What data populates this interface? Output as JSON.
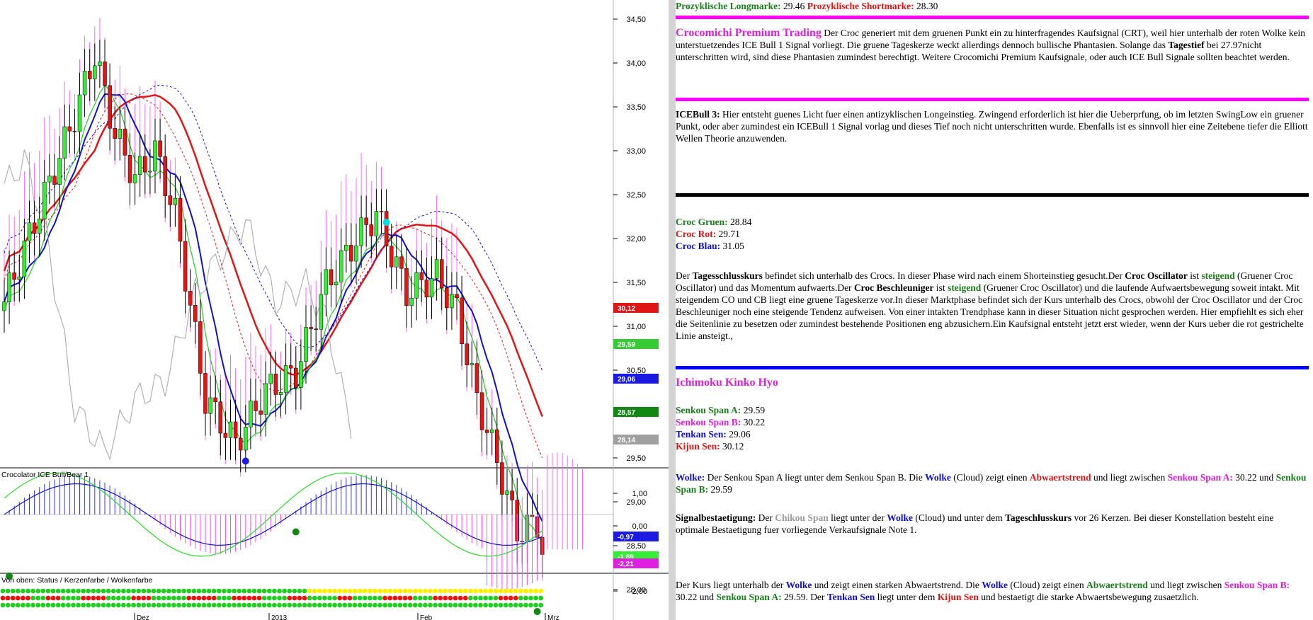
{
  "chart": {
    "price_axis": [
      "34,50",
      "34,00",
      "33,50",
      "33,00",
      "32,50",
      "32,00",
      "31,50",
      "31,00",
      "30,50",
      "30,00",
      "29,50",
      "29,00",
      "28,50",
      "28,00"
    ],
    "osc_axis": [
      "1,00",
      "0,00",
      "-1,00",
      "-2,00"
    ],
    "time_axis": [
      "Dez",
      "2013",
      "Feb",
      "Mrz"
    ],
    "price_markers": [
      {
        "text": "30,12",
        "color": "#e01616"
      },
      {
        "text": "29,59",
        "color": "#33cc33"
      },
      {
        "text": "29,06",
        "color": "#1a1ae0"
      },
      {
        "text": "28,57",
        "color": "#118811"
      },
      {
        "text": "28,14",
        "color": "#a0a0a0"
      }
    ],
    "osc_markers": [
      {
        "text": "-0,97",
        "color": "#1a1ae0"
      },
      {
        "text": "-1,89",
        "color": "#33ee33"
      },
      {
        "text": "-2,21",
        "color": "#e020e0"
      }
    ],
    "osc_title": "Crocolator  ICE Bull/Bear 1",
    "status_title": "Von oben: Status / Kerzenfarbe / Wolkenfarbe",
    "rows": [
      "GGGGGGGGGGGGGGGGGGGGGGGGGGGGGGGGGGGGGGGGGGGGGGGGGGGGGGGGGGGGGYYYYYYYYYYYYYYYYYYYYYYYYYYYYYYYYYYYYYYYYYYYYYYYYGGGGGGGGGGGGGGGGGGGGGGGGGGGGRRRRRRRRRRRRRRRRRRRR",
      "RRRRRRGGGRRRGGGGRRRRRGGGGGRRRRGGGGGGGRRRRRRGGGRRRRRRGGGGGRRRRGGGGGGRRRGGGGGGRRRRRRGGGGRRRRRRRGGGGGGRRRRGGGGGGRRRRRGGGGGGGRRRRRRRGGGGGRRRRRGGGRRRRRRRGGRRRR",
      "GGGGGGGGGGGGGGGGGGGGGGGGGGGGGGGGGGGGGGGGGGGGGGGGGGGGGGGGGGGGGGGGGGGGGGGGGGGGGGGGGGGGGGGGGGGGGGGGGGGGGGGGGGGGGGGGGGGGGGGGGRRRRRRRRRRRRRRRRRRRRRRRRRRRRRRRRRRR"
    ]
  },
  "panel": {
    "line1_long_label": "Prozyklische Longmarke:",
    "line1_long_value": "29.46",
    "line1_short_label": "Prozyklische Shortmarke:",
    "line1_short_value": "28.30",
    "crt_title": "Crocomichi Premium Trading",
    "crt_text1": " Der Croc generiert mit dem gruenen Punkt ein zu hinterfragendes Kaufsignal (CRT), weil hier unterhalb der roten Wolke kein unterstuetzendes ICE Bull 1 Signal vorliegt. Die gruene Tageskerze weckt allerdings dennoch bullische Phantasien. Solange das ",
    "crt_bold": "Tagestief",
    "crt_text2": " bei 27.97nicht unterschritten wird, sind diese Phantasien zumindest berechtigt. Weitere Crocomichi Premium Kaufsignale, oder auch ICE Bull Signale sollten beachtet werden.",
    "ice_title": "ICEBull 3:",
    "ice_text": " Hier entsteht guenes Licht fuer einen antizyklischen Longeinstieg. Zwingend erforderlich ist hier die Ueberprfung, ob im letzten SwingLow ein gruener Punkt, oder aber zumindest ein ICEBull 1 Signal vorlag und dieses Tief noch nicht unterschritten wurde. Ebenfalls ist es sinnvoll hier eine Zeitebene tiefer die Elliott Wellen Theorie anzuwenden.",
    "croc_green_label": "Croc Gruen:",
    "croc_green_value": " 28.84",
    "croc_red_label": "Croc Rot:",
    "croc_red_value": " 29.71",
    "croc_blue_label": "Croc Blau:",
    "croc_blue_value": " 31.05",
    "desc_1": "Der ",
    "desc_b1": "Tagesschlusskurs",
    "desc_2": " befindet sich unterhalb des Crocs. In dieser Phase wird nach einem Shorteinstieg gesucht.Der ",
    "desc_b2": "Croc Oscillator",
    "desc_3": " ist ",
    "desc_g1": "steigend",
    "desc_4": " (Gruener Croc Oscillator) und das Momentum aufwaerts.Der ",
    "desc_b3": "Croc Beschleuniger",
    "desc_5": " ist ",
    "desc_g2": "steigend",
    "desc_6": " (Gruener Croc Oscillator) und die laufende Aufwaertsbewegung soweit intakt. Mit steigendem CO und CB liegt eine gruene Tageskerze vor.In dieser Marktphase befindet sich der Kurs unterhalb des Crocs, obwohl der Croc Oscillator und der Croc Beschleuniger noch eine steigende Tendenz aufweisen. Von einer intakten Trendphase kann in dieser Situation nicht gesprochen werden. Hier empfiehlt es sich eher die Seitenlinie zu besetzen oder zumindest bestehende Positionen eng abzusichern.Ein Kaufsignal entsteht jetzt erst wieder, wenn der Kurs ueber die rot gestrichelte Linie ansteigt.,",
    "ichi_title": "Ichimoku Kinko Hyo",
    "ssa_label": "Senkou Span A:",
    "ssa_value": " 29.59",
    "ssb_label": "Senkou Span B:",
    "ssb_value": " 30.22",
    "tenkan_label": "Tenkan Sen:",
    "tenkan_value": " 29.06",
    "kijun_label": "Kijun Sen:",
    "kijun_value": " 30.12",
    "wolke_label": "Wolke:",
    "wolke_t1": " Der Senkou Span A liegt unter dem Senkou Span B. Die ",
    "wolke_w": "Wolke",
    "wolke_t2": " (Cloud) zeigt einen ",
    "wolke_trend": "Abwaertstrend",
    "wolke_t3": " und liegt zwischen ",
    "wolke_ssb": "Senkou Span A:",
    "wolke_t4": " 30.22 und ",
    "wolke_ssa": "Senkou Span B:",
    "wolke_t5": " 29.59",
    "sig_label": "Signalbestaetigung:",
    "sig_t1": " Der ",
    "sig_chikou": "Chikou Span",
    "sig_t2": " liegt unter der ",
    "sig_w": "Wolke",
    "sig_t3": " (Cloud) und unter dem ",
    "sig_tsk": "Tageschlusskurs",
    "sig_t4": " vor 26 Kerzen. Bei dieser Konstellation besteht eine optimale Bestaetigung fuer vorliegende Verkaufsignale Note 1.",
    "last_t1": "Der Kurs liegt unterhalb der ",
    "last_w1": "Wolke",
    "last_t2": " und zeigt einen starken Abwaertstrend. Die ",
    "last_w2": "Wolke",
    "last_t3": " (Cloud) zeigt einen ",
    "last_trend": "Abwaertstrend",
    "last_t4": " und liegt zwischen ",
    "last_ssb": "Senkou Span B:",
    "last_t5": " 30.22 und ",
    "last_ssa": "Senkou Span A:",
    "last_t6": " 29.59. Der ",
    "last_tenkan": "Tenkan Sen",
    "last_t7": " liegt unter dem ",
    "last_kijun": "Kijun Sen",
    "last_t8": " und bestaetigt die starke Abwaertsbewegung zusaetzlich."
  }
}
